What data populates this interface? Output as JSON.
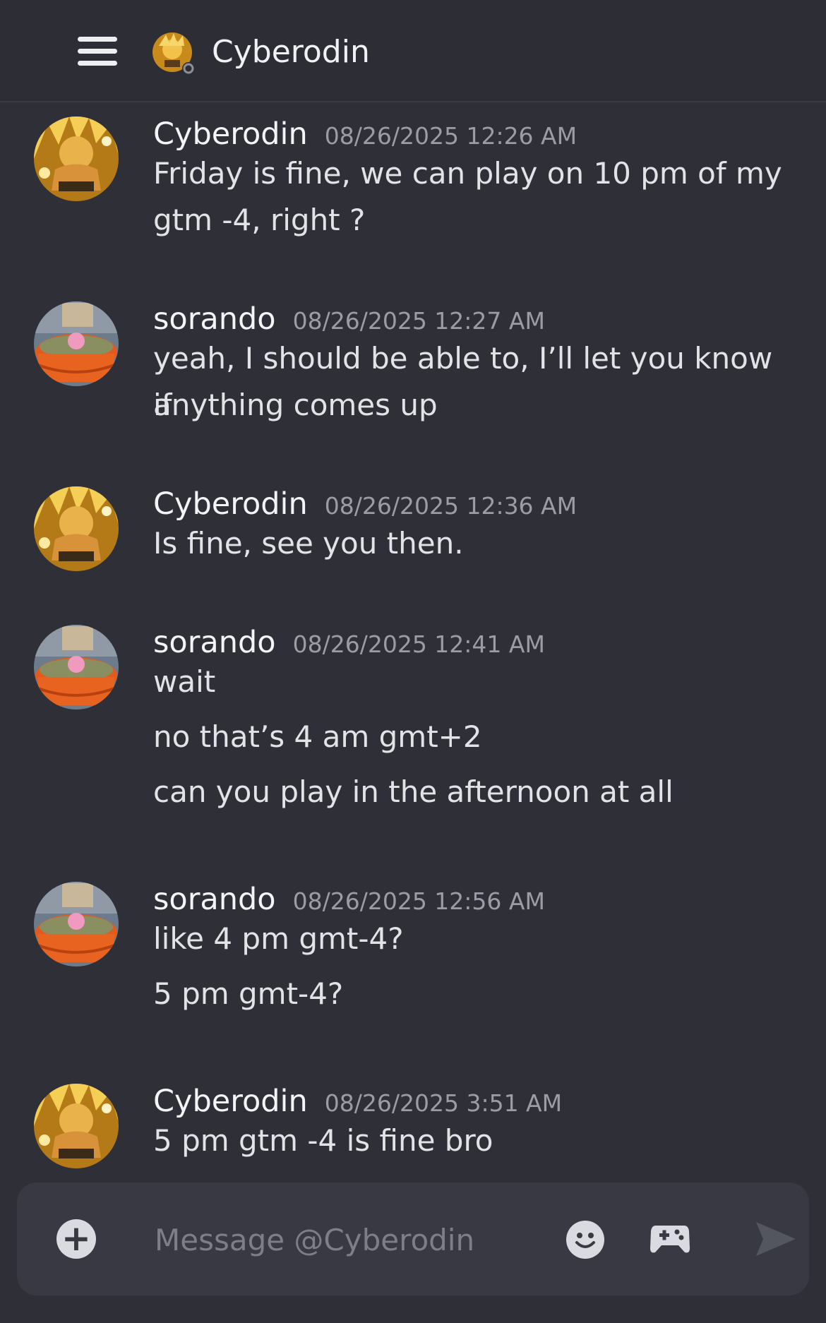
{
  "header": {
    "title": "Cyberodin",
    "menu_icon": "hamburger-menu-icon",
    "avatar_icon": "user-avatar-with-status-icon"
  },
  "messages": [
    {
      "author": "Cyberodin",
      "time": "08/26/2025 12:26 AM",
      "avatar": "cyberodin",
      "lines": [
        "Friday is fine, we can play on 10 pm of my",
        "gtm -4, right ?"
      ]
    },
    {
      "author": "sorando",
      "time": "08/26/2025 12:27 AM",
      "avatar": "sorando",
      "lines": [
        "yeah, I should be able to, I’ll let you know if",
        "anything comes up"
      ]
    },
    {
      "author": "Cyberodin",
      "time": "08/26/2025 12:36 AM",
      "avatar": "cyberodin",
      "lines": [
        "Is fine, see you then."
      ]
    },
    {
      "author": "sorando",
      "time": "08/26/2025 12:41 AM",
      "avatar": "sorando",
      "lines": [
        "wait",
        "no that’s 4 am gmt+2",
        "can you play in the afternoon at all"
      ]
    },
    {
      "author": "sorando",
      "time": "08/26/2025 12:56 AM",
      "avatar": "sorando",
      "lines": [
        "like 4 pm gmt-4?",
        "5 pm gmt-4?"
      ]
    },
    {
      "author": "Cyberodin",
      "time": "08/26/2025 3:51 AM",
      "avatar": "cyberodin",
      "lines": [
        "5 pm gtm -4 is fine bro"
      ]
    }
  ],
  "composer": {
    "placeholder": "Message @Cyberodin",
    "icons": [
      "plus-icon",
      "emoji-icon",
      "gamepad-icon",
      "send-icon"
    ]
  },
  "colors": {
    "background": "#2f3037",
    "composer": "#383942",
    "timestamp": "#9a9ca6"
  }
}
